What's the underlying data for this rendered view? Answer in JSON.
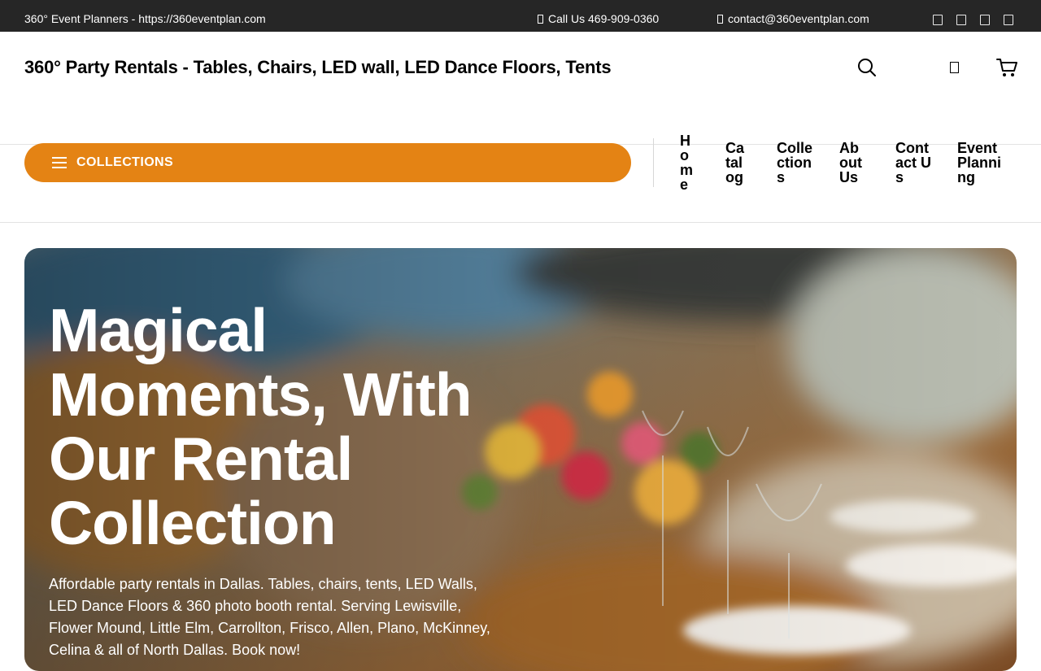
{
  "topbar": {
    "company": "360° Event Planners - https://360eventplan.com",
    "phone": "Call Us 469-909-0360",
    "email": "contact@360eventplan.com"
  },
  "header": {
    "title": "360° Party Rentals - Tables, Chairs, LED wall, LED Dance Floors, Tents"
  },
  "nav": {
    "collections_label": "COLLECTIONS",
    "items": [
      "Home",
      "Catalog",
      "Collections",
      "About Us",
      "Contact Us",
      "Event Planning"
    ]
  },
  "hero": {
    "title": "Magical Moments, With Our Rental Collection",
    "subtitle": "Affordable party rentals in Dallas. Tables, chairs, tents, LED Walls, LED Dance Floors & 360 photo booth rental. Serving Lewisville, Flower Mound, Little Elm, Carrollton, Frisco, Allen, Plano, McKinney, Celina & all of North Dallas. Book now!"
  },
  "colors": {
    "topbar_bg": "#262626",
    "accent": "#e48314"
  }
}
